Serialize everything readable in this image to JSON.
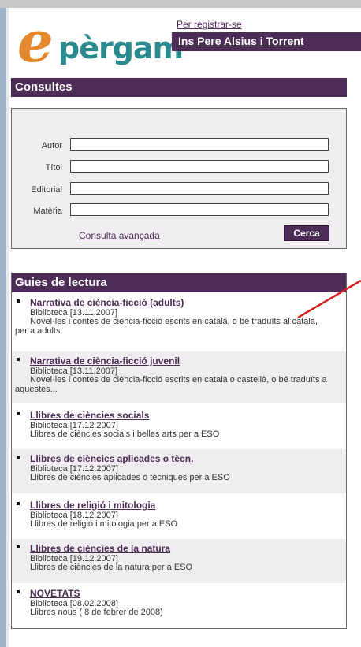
{
  "header": {
    "logo_e": "e",
    "logo_rest": "pèrgam",
    "register_link": "Per registrar-se",
    "school_name": "Ins Pere Alsius i Torrent"
  },
  "search": {
    "title": "Consultes",
    "fields": [
      {
        "label": "Autor",
        "value": ""
      },
      {
        "label": "Títol",
        "value": ""
      },
      {
        "label": "Editorial",
        "value": ""
      },
      {
        "label": "Matèria",
        "value": ""
      }
    ],
    "advanced_link": "Consulta avançada",
    "button_label": "Cerca"
  },
  "guides": {
    "title": "Guies de lectura",
    "items": [
      {
        "title": "Narrativa de ciència-ficció (adults)",
        "meta": "Biblioteca [13.11.2007]",
        "desc": "Novel·les i contes de ciència-ficció escrits en català, o bé traduïts al català, per a adults."
      },
      {
        "title": "Narrativa de ciència-ficció juvenil",
        "meta": "Biblioteca [13.11.2007]",
        "desc": "Novel·les i contes de ciència-ficció escrits en català o castellà, o bé traduïts a aquestes..."
      },
      {
        "title": "Llibres de ciències socials",
        "meta": "Biblioteca [17.12.2007]",
        "desc": "Llibres de ciències socials i belles arts per a ESO"
      },
      {
        "title": "Llibres de ciències aplicades o tècn.",
        "meta": "Biblioteca [17.12.2007]",
        "desc": "Llibres de ciències aplicades o tècniques per a ESO"
      },
      {
        "title": "Llibres de religió i mitologia",
        "meta": "Biblioteca [18.12.2007]",
        "desc": "Llibres de religió i mitologia per a ESO"
      },
      {
        "title": "Llibres de ciències de la natura",
        "meta": "Biblioteca [19.12.2007]",
        "desc": "Llibres de ciències de la natura per a ESO"
      },
      {
        "title": "NOVETATS",
        "meta": "Biblioteca [08.02.2008]",
        "desc": "Llibres nous ( 8 de febrer de 2008)"
      }
    ]
  },
  "colors": {
    "brand": "#4d2c57",
    "logo_orange": "#e6882e",
    "logo_teal": "#2a8a8e",
    "annotation": "#d42020"
  },
  "annotation": {
    "icon": "red-arrow-line"
  }
}
